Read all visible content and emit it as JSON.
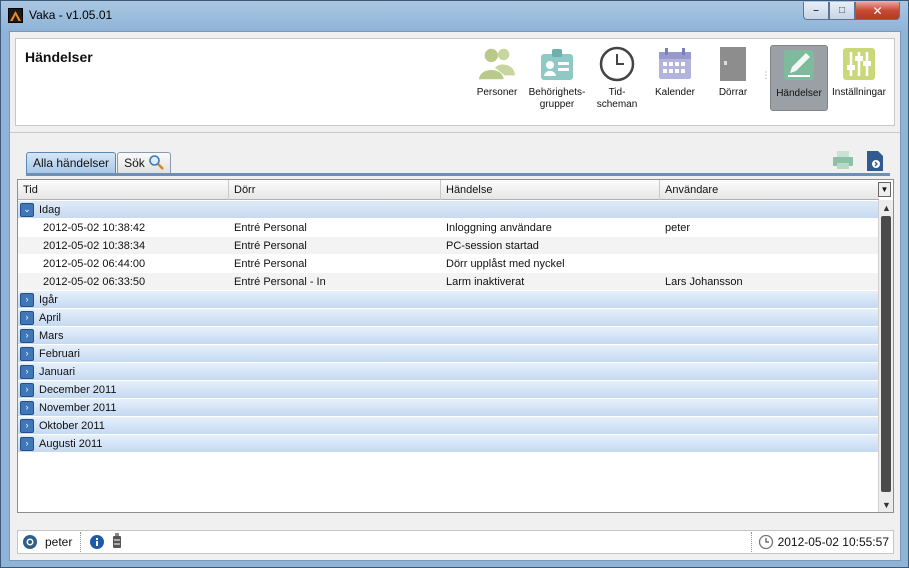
{
  "window": {
    "title": "Vaka - v1.05.01"
  },
  "header": {
    "page_title": "Händelser"
  },
  "toolbar": {
    "items": [
      {
        "label": "Personer"
      },
      {
        "label": "Behörighets-\ngrupper"
      },
      {
        "label": "Tid-\nscheman"
      },
      {
        "label": "Kalender"
      },
      {
        "label": "Dörrar"
      },
      {
        "label": "Händelser"
      },
      {
        "label": "Inställningar"
      }
    ]
  },
  "tabs": {
    "all": "Alla händelser",
    "search": "Sök"
  },
  "grid": {
    "columns": [
      "Tid",
      "Dörr",
      "Händelse",
      "Användare"
    ],
    "today_group": "Idag",
    "rows": [
      {
        "tid": "2012-05-02 10:38:42",
        "dorr": "Entré Personal",
        "handelse": "Inloggning användare",
        "anvandare": "peter"
      },
      {
        "tid": "2012-05-02 10:38:34",
        "dorr": "Entré Personal",
        "handelse": "PC-session startad",
        "anvandare": ""
      },
      {
        "tid": "2012-05-02 06:44:00",
        "dorr": "Entré Personal",
        "handelse": "Dörr upplåst med nyckel",
        "anvandare": ""
      },
      {
        "tid": "2012-05-02 06:33:50",
        "dorr": "Entré Personal - In",
        "handelse": "Larm inaktiverat",
        "anvandare": "Lars Johansson"
      }
    ],
    "collapsed_groups": [
      "Igår",
      "April",
      "Mars",
      "Februari",
      "Januari",
      "December 2011",
      "November 2011",
      "Oktober 2011",
      "Augusti 2011"
    ]
  },
  "status": {
    "user": "peter",
    "datetime": "2012-05-02 10:55:57"
  }
}
